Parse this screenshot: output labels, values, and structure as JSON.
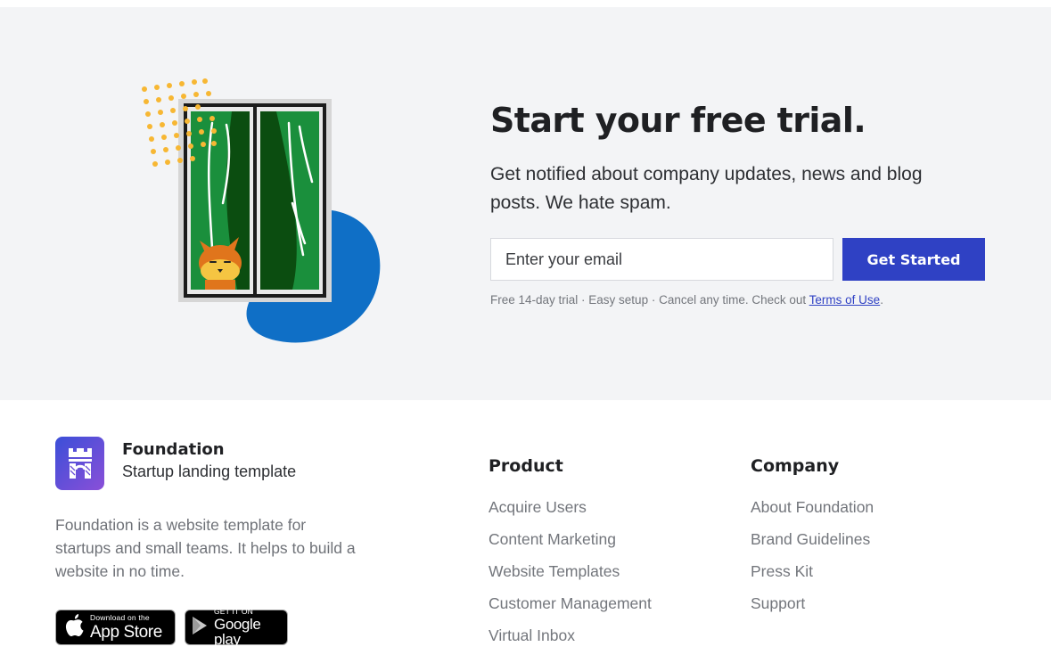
{
  "cta": {
    "title": "Start your free trial.",
    "subtitle": "Get notified about company updates, news and blog posts. We hate spam.",
    "email_placeholder": "Enter your email",
    "button_label": "Get Started",
    "fine_print": "Free 14-day trial · Easy setup · Cancel any time. Check out ",
    "terms_link": "Terms of Use",
    "fine_print_end": "."
  },
  "illustration": {
    "icon": "window-fox-illustration",
    "colors": {
      "dots": "#f7b733",
      "blob": "#0f6fc6",
      "curtain": "#1a8f3c",
      "curtain_dark": "#0b4d10",
      "fox": "#e0751c",
      "fox_face": "#f5c542"
    }
  },
  "brand": {
    "name": "Foundation",
    "tagline": "Startup landing template",
    "description": "Foundation is a website template for startups and small teams. It helps to build a website in no time.",
    "logo_icon": "castle-icon"
  },
  "badges": {
    "app_store_small": "Download on the",
    "app_store_large": "App Store",
    "google_play_small": "GET IT ON",
    "google_play_large": "Google play"
  },
  "product": {
    "heading": "Product",
    "links": [
      "Acquire Users",
      "Content Marketing",
      "Website Templates",
      "Customer Management",
      "Virtual Inbox"
    ]
  },
  "company": {
    "heading": "Company",
    "links": [
      "About Foundation",
      "Brand Guidelines",
      "Press Kit",
      "Support"
    ]
  },
  "colors": {
    "accent": "#2f41c4",
    "section_bg": "#f3f4f6",
    "muted_text": "#73767c"
  }
}
